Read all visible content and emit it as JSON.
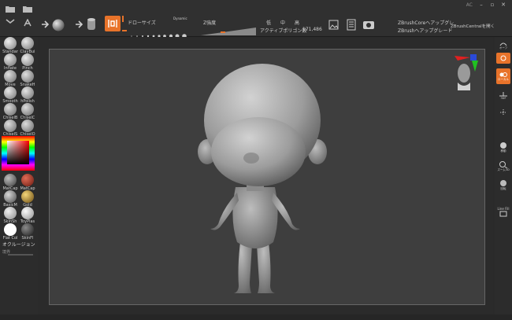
{
  "toolbar": {
    "draw_size_label": "ドローサイズ",
    "dynamic_label": "Dynamic",
    "z_intensity_label": "Z強度",
    "quality": [
      "低",
      "中",
      "高"
    ],
    "active_polys_label": "アクティブポリゴン数",
    "active_polys_value": "171,486",
    "zbrushcore_upgrade": "ZBrushCoreへアップグレ",
    "zbrush_upgrade": "ZBrushへアップグレード",
    "zbrushcentral_open": "ZBrushCentralを開く",
    "ac_label": "AC"
  },
  "brushes": [
    {
      "label": "Standar",
      "color": "#c9c9c9"
    },
    {
      "label": "ClayBui",
      "color": "#bdbdbd"
    },
    {
      "label": "Inflate",
      "color": "#bcbcbc"
    },
    {
      "label": "Pinch",
      "color": "#c4c4c4"
    },
    {
      "label": "Move",
      "color": "#b8b8b8"
    },
    {
      "label": "SnakeH",
      "color": "#b6b6b6"
    },
    {
      "label": "Smooth",
      "color": "#c2c2c2"
    },
    {
      "label": "hPolish",
      "color": "#bfbfbf"
    },
    {
      "label": "ChiselB",
      "color": "#b3b3b3"
    },
    {
      "label": "ChiselC",
      "color": "#b5b5b5"
    },
    {
      "label": "ChiselS",
      "color": "#b7b7b7"
    },
    {
      "label": "ChiselO",
      "color": "#b4b4b4"
    }
  ],
  "materials": [
    {
      "label": "MatCap",
      "color": "#8a8a8a"
    },
    {
      "label": "MatCap",
      "color": "#b33a2a"
    },
    {
      "label": "BasicM",
      "color": "#9a9a9a"
    },
    {
      "label": "Gold",
      "color": "#b8902e"
    },
    {
      "label": "SkinSh",
      "color": "#bdbdbd"
    },
    {
      "label": "ToyPlas",
      "color": "#c7c7c7"
    },
    {
      "label": "Flat Col",
      "color": "#ffffff"
    },
    {
      "label": "SkinFl",
      "color": "#3a3a3a"
    }
  ],
  "occlusion_label": "オクルージョン",
  "color_label": "境界",
  "right_panel": [
    {
      "label": "オーフ",
      "icon": "orbit-icon"
    },
    {
      "label": "",
      "icon": "rotate-icon"
    },
    {
      "label": "ローカル",
      "icon": "local-icon"
    },
    {
      "label": "3DF",
      "icon": "floor-icon"
    },
    {
      "label": "",
      "icon": "symmetry-icon"
    },
    {
      "label": "移動",
      "icon": "move-icon"
    },
    {
      "label": "ズーム3D",
      "icon": "zoom-icon"
    },
    {
      "label": "回転",
      "icon": "rotate3d-icon"
    },
    {
      "label": "Line Fill",
      "icon": "linefill-icon"
    }
  ],
  "colors": {
    "accent": "#e8732a",
    "panel": "#2c2c2c",
    "canvas": "#3e3e3e"
  }
}
